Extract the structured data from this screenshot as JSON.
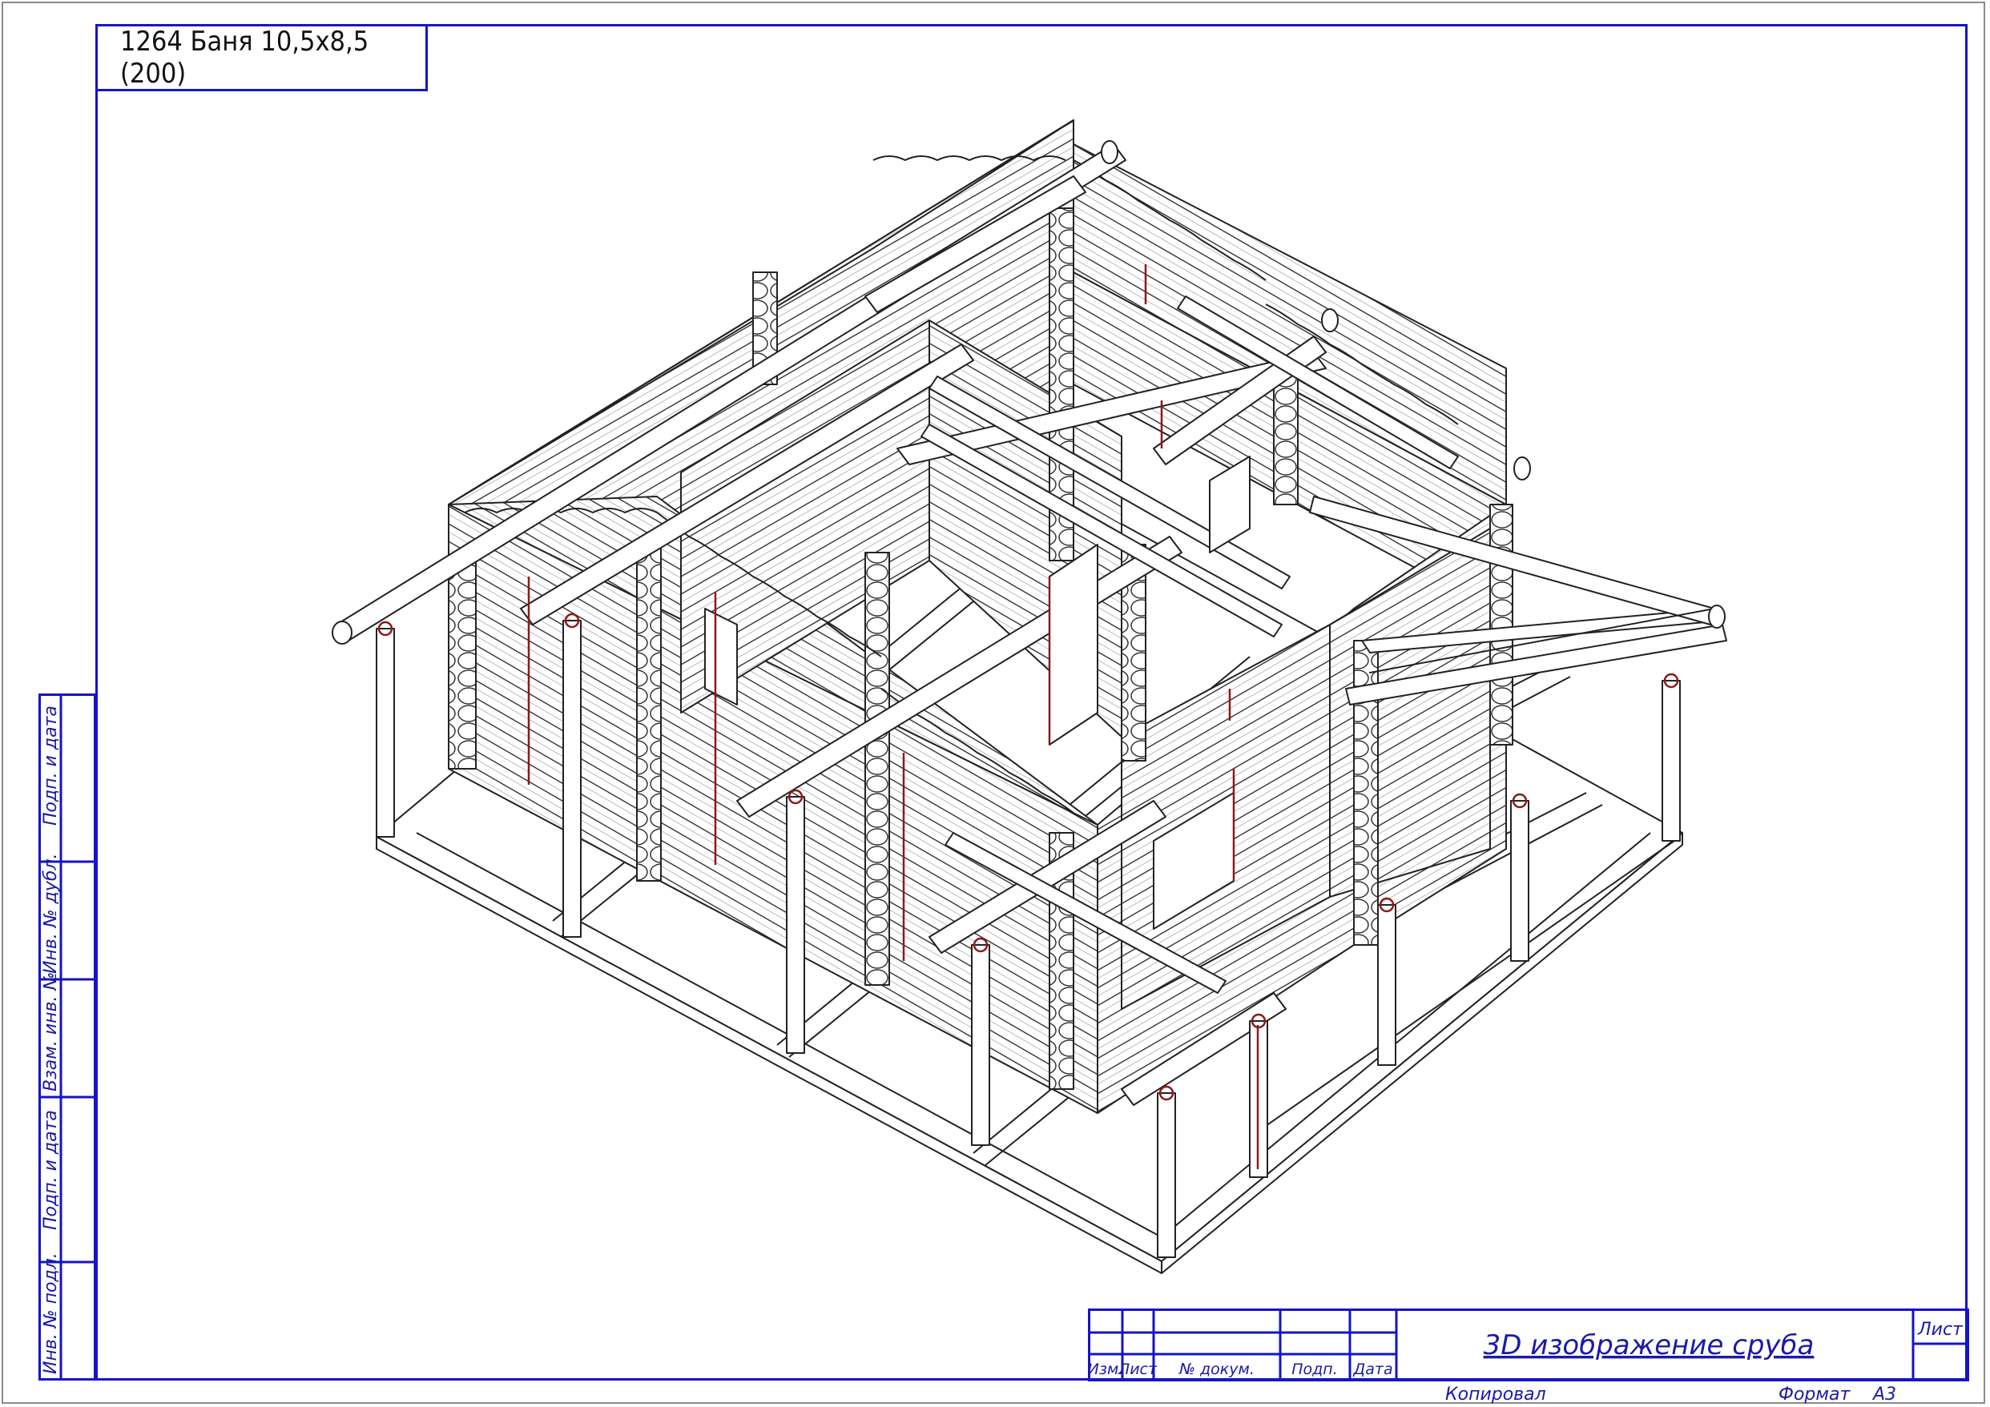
{
  "drawing_title": "1264 Баня 10,5х8,5 (200)",
  "side_stamp": {
    "cells": [
      "Подп. и дата",
      "Инв. № дубл.",
      "Взам. инв. №",
      "Подп. и дата",
      "Инв. № подл."
    ]
  },
  "title_block": {
    "sheet_name": "3D изображение сруба",
    "columns": [
      "Изм.",
      "Лист",
      "№ докум.",
      "Подп.",
      "Дата"
    ],
    "sheet_label": "Лист",
    "copied_label": "Копировал",
    "format_label": "Формат",
    "format_value": "А3"
  },
  "colors": {
    "frame": "#1414c8",
    "linework": "#222222",
    "accent": "#8b1a1a"
  }
}
